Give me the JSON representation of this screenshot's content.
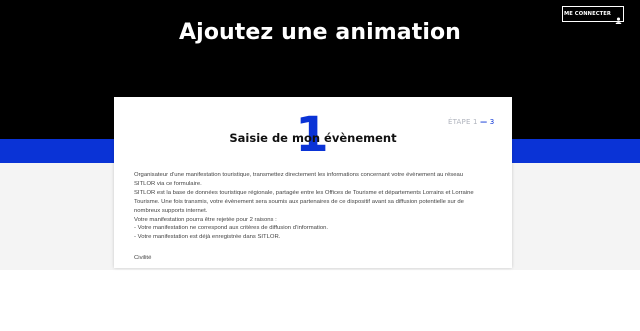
{
  "header": {
    "title": "Ajoutez une animation",
    "login_label": "ME CONNECTER",
    "login_icon": "user-icon"
  },
  "form": {
    "step_number": "1",
    "step_title": "Saisie de mon évènement",
    "step_indicator": {
      "label": "ÉTAPE 1",
      "separator": "—",
      "total": "3"
    },
    "intro_lines": [
      "Organisateur d’une manifestation touristique, transmettez directement les informations concernant votre évènement au réseau",
      "SITLOR via ce formulaire.",
      "SITLOR est la base de données touristique régionale, partagée entre les Offices de Tourisme et départements Lorrains et Lorraine",
      "Tourisme. Une fois transmis, votre évènement sera soumis aux partenaires de ce dispositif avant sa diffusion potentielle sur de",
      "nombreux supports internet.",
      "Votre manifestation pourra être rejetée pour 2 raisons :",
      "- Votre manifestation ne correspond aux critères de diffusion d’information.",
      "- Votre manifestation est déjà enregistrée dans SITLOR."
    ],
    "civilite_label": "Civilité"
  },
  "colors": {
    "header_bg": "#000000",
    "accent_blue": "#0a33d6",
    "section_bg": "#f4f4f4"
  }
}
